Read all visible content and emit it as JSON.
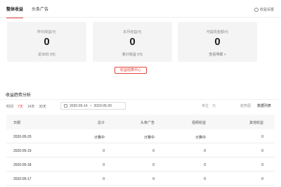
{
  "tabs": [
    {
      "label": "整体收益"
    },
    {
      "label": "头条广告"
    }
  ],
  "settings_label": "收益设置",
  "cards": [
    {
      "label": "昨日收益/元",
      "value": "0",
      "sub": "近30日 0元"
    },
    {
      "label": "本月收益/元",
      "value": "0",
      "sub": "累计收益 0元"
    },
    {
      "label": "可提现金额/元",
      "value": "0",
      "sub": "查看明细 >"
    }
  ],
  "center_button": "收益结算中心",
  "section_title": "收益趋势分析",
  "filters": {
    "label": "时间",
    "options": [
      "7天",
      "14天",
      "30天"
    ],
    "date_start": "2020-05-14",
    "date_sep": "~",
    "date_end": "2020-05-20",
    "unit_label": "单位",
    "unit_value": "元",
    "view_chart": "趋势图",
    "view_list": "数据列表"
  },
  "table": {
    "headers": [
      "日期",
      "总计",
      "头条广告",
      "视频收益",
      "其他收益"
    ],
    "rows": [
      [
        "2020-05-20",
        "计算中",
        "计算中",
        "计算中",
        "0"
      ],
      [
        "2020-05-19",
        "0",
        "0",
        "0",
        "0"
      ],
      [
        "2020-05-18",
        "0",
        "0",
        "0",
        "0"
      ],
      [
        "2020-05-17",
        "0",
        "0",
        "0",
        "0"
      ]
    ]
  }
}
